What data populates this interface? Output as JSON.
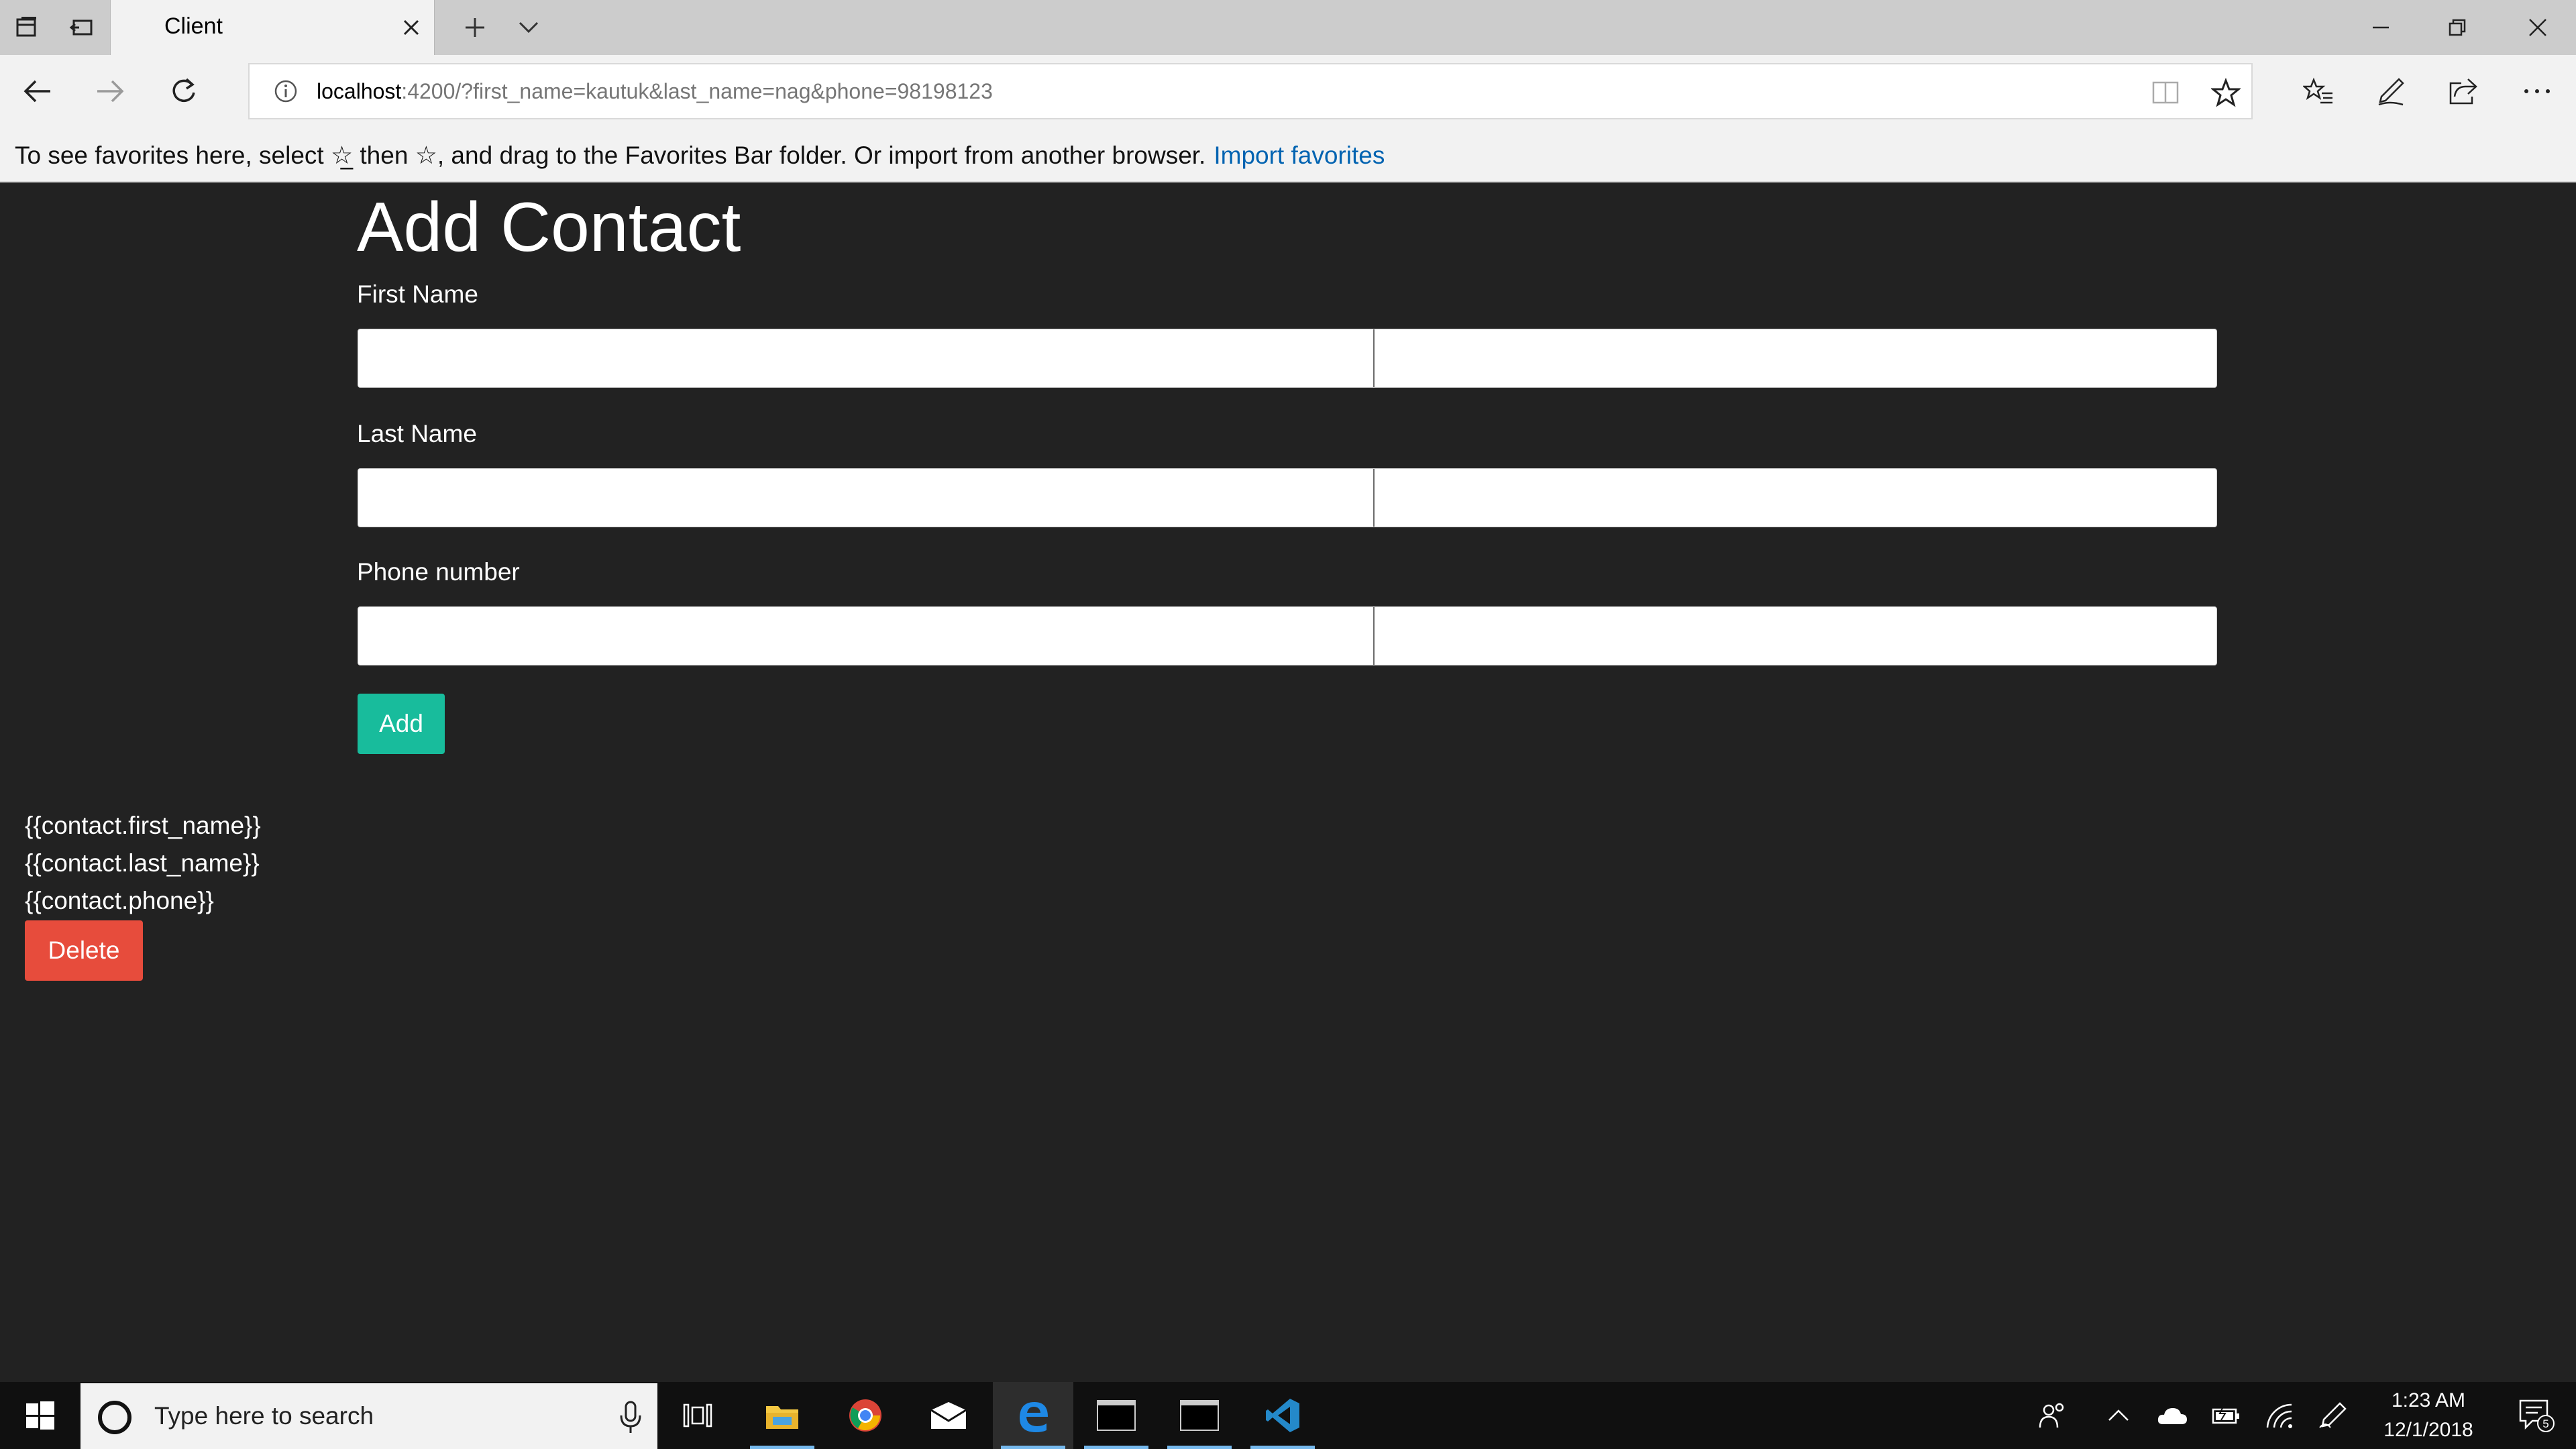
{
  "browser": {
    "tab_title": "Client",
    "url_host": "localhost",
    "url_rest": ":4200/?first_name=kautuk&last_name=nag&phone=98198123"
  },
  "favorites_bar": {
    "message": "To see favorites here, select  ☆̲  then ☆, and drag to the Favorites Bar folder. Or import from another browser.",
    "import_link": "Import favorites"
  },
  "form": {
    "heading": "Add Contact",
    "first_name_label": "First Name",
    "last_name_label": "Last Name",
    "phone_label": "Phone number",
    "add_label": "Add"
  },
  "contact": {
    "first_name": "{{contact.first_name}}",
    "last_name": "{{contact.last_name}}",
    "phone": "{{contact.phone}}",
    "delete_label": "Delete"
  },
  "taskbar": {
    "search_placeholder": "Type here to search",
    "time": "1:23 AM",
    "date": "12/1/2018",
    "notification_count": "5",
    "apps": [
      "task-view",
      "file-explorer",
      "chrome",
      "mail",
      "edge",
      "terminal-1",
      "terminal-2",
      "vscode"
    ]
  },
  "colors": {
    "page_background": "#222222",
    "add_button": "#18bc9c",
    "delete_button": "#e74c3c",
    "link": "#0063b1"
  }
}
